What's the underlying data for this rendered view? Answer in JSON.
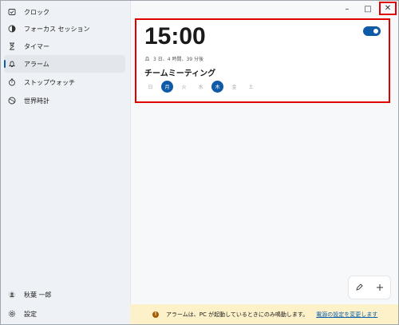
{
  "sidebar": {
    "items": [
      {
        "label": "クロック",
        "icon": "clock-icon"
      },
      {
        "label": "フォーカス セッション",
        "icon": "focus-icon"
      },
      {
        "label": "タイマー",
        "icon": "hourglass-icon"
      },
      {
        "label": "アラーム",
        "icon": "bell-icon",
        "active": true
      },
      {
        "label": "ストップウォッチ",
        "icon": "stopwatch-icon"
      },
      {
        "label": "世界時計",
        "icon": "globe-icon"
      }
    ],
    "user_name": "秋葉 一郎",
    "settings_label": "設定"
  },
  "window": {
    "minimize_label": "–",
    "maximize_label": "□",
    "close_label": "✕"
  },
  "alarm": {
    "time": "15:00",
    "remaining": "3 日、4 時間、39 分後",
    "name": "チームミーティング",
    "enabled": true,
    "days": [
      {
        "label": "日",
        "on": false
      },
      {
        "label": "月",
        "on": true
      },
      {
        "label": "火",
        "on": false
      },
      {
        "label": "水",
        "on": false
      },
      {
        "label": "木",
        "on": true
      },
      {
        "label": "金",
        "on": false
      },
      {
        "label": "土",
        "on": false
      }
    ]
  },
  "infobar": {
    "message": "アラームは、PC が起動しているときにのみ鳴動します。",
    "link": "電源の設定を変更します"
  },
  "colors": {
    "accent": "#0f5aa6",
    "highlight_border": "#e00000",
    "info_background": "#fcf1c9"
  }
}
